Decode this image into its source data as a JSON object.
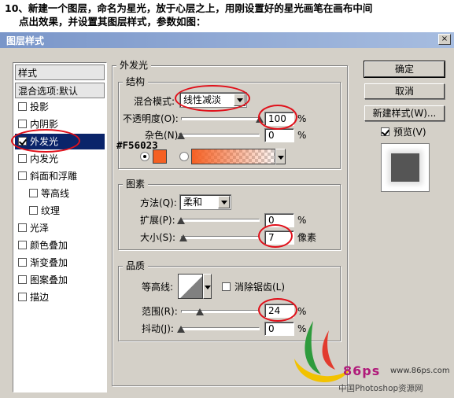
{
  "caption": {
    "line1": "10、新建一个图层，命名为星光，放于心层之上，用刚设置好的星光画笔在画布中间",
    "line2": "点出效果，并设置其图层样式，参数如图："
  },
  "dialog": {
    "title": "图层样式",
    "close_label": "×"
  },
  "sidebar": {
    "header": "样式",
    "blend_options": "混合选项:默认",
    "items": [
      {
        "label": "投影",
        "checked": false
      },
      {
        "label": "内阴影",
        "checked": false
      },
      {
        "label": "外发光",
        "checked": true
      },
      {
        "label": "内发光",
        "checked": false
      },
      {
        "label": "斜面和浮雕",
        "checked": false
      },
      {
        "label": "等高线",
        "checked": false
      },
      {
        "label": "纹理",
        "checked": false
      },
      {
        "label": "光泽",
        "checked": false
      },
      {
        "label": "颜色叠加",
        "checked": false
      },
      {
        "label": "渐变叠加",
        "checked": false
      },
      {
        "label": "图案叠加",
        "checked": false
      },
      {
        "label": "描边",
        "checked": false
      }
    ]
  },
  "main": {
    "section_title": "外发光",
    "structure": {
      "title": "结构",
      "blend_mode_label": "混合模式:",
      "blend_mode_value": "线性减淡",
      "opacity_label": "不透明度(O):",
      "opacity_value": "100",
      "opacity_fraction": 1.0,
      "noise_label": "杂色(N):",
      "noise_value": "0",
      "noise_fraction": 0.0,
      "percent": "%",
      "color_hex_label": "#F56023",
      "swatch_color": "#F56023"
    },
    "elements": {
      "title": "图素",
      "technique_label": "方法(Q):",
      "technique_value": "柔和",
      "spread_label": "扩展(P):",
      "spread_value": "0",
      "spread_fraction": 0.0,
      "size_label": "大小(S):",
      "size_value": "7",
      "size_unit": "像素",
      "size_fraction": 0.03,
      "percent": "%"
    },
    "quality": {
      "title": "品质",
      "contour_label": "等高线:",
      "antialias_label": "消除锯齿(L)",
      "antialias_checked": false,
      "range_label": "范围(R):",
      "range_value": "24",
      "range_fraction": 0.24,
      "jitter_label": "抖动(J):",
      "jitter_value": "0",
      "jitter_fraction": 0.0,
      "percent": "%"
    }
  },
  "buttons": {
    "ok": "确定",
    "cancel": "取消",
    "new_style": "新建样式(W)...",
    "preview_label": "预览(V)",
    "preview_checked": true
  },
  "watermark": {
    "brand": "86ps",
    "url": "www.86ps.com",
    "site_name": "中国Photoshop资源网"
  },
  "colors": {
    "annotation_red": "#e0101a",
    "selection_blue": "#0a246a",
    "dialog_gray": "#d4d0c8"
  }
}
